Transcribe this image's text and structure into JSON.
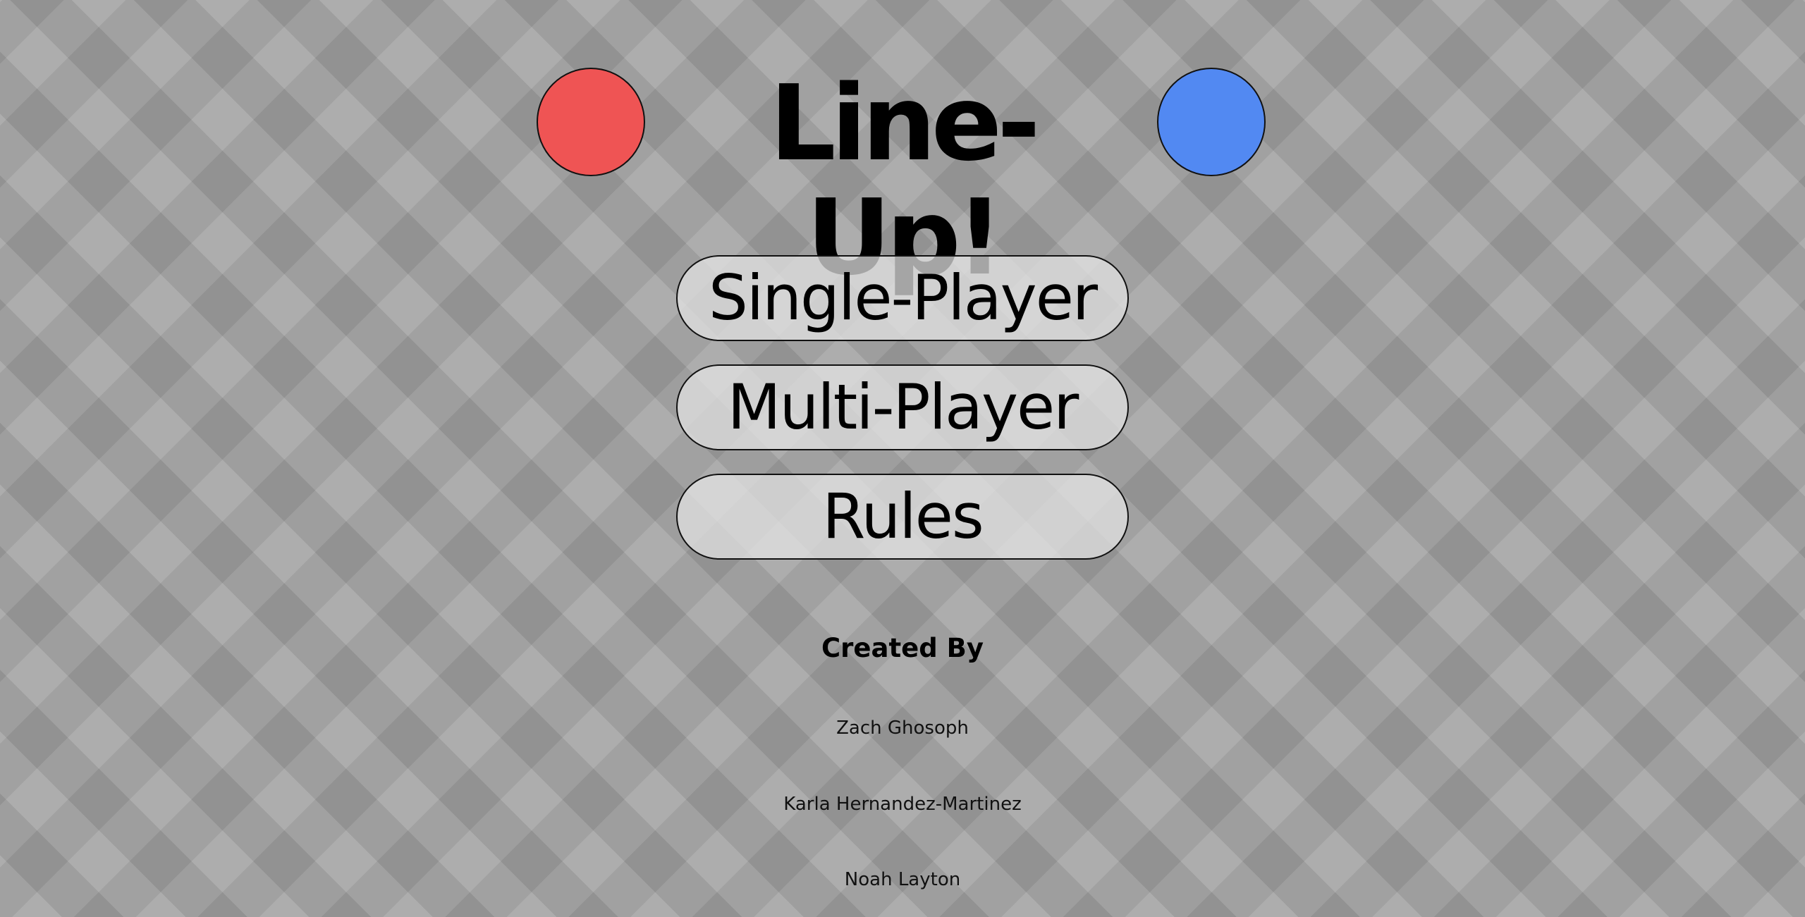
{
  "header": {
    "title": "Line-Up!",
    "left_token_color": "#ef5454",
    "right_token_color": "#5289f2"
  },
  "menu": {
    "single_player_label": "Single-Player",
    "multi_player_label": "Multi-Player",
    "rules_label": "Rules"
  },
  "credits": {
    "heading": "Created By",
    "authors": [
      "Zach Ghosoph",
      "Karla Hernandez-Martinez",
      "Noah Layton"
    ]
  }
}
